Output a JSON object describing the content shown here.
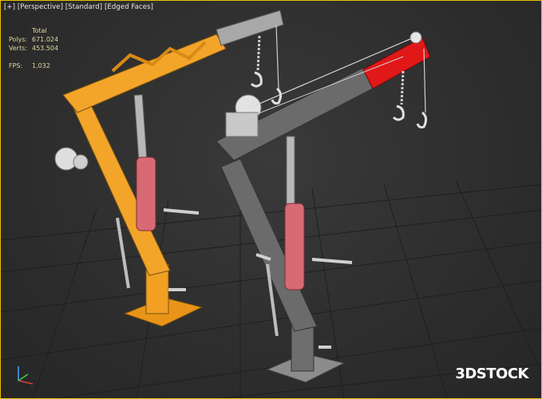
{
  "viewport": {
    "label_parts": [
      "[+]",
      "[Perspective]",
      "[Standard]",
      "[Edged Faces]"
    ],
    "stats": {
      "header": "Total",
      "polys_label": "Polys:",
      "polys_value": "671.024",
      "verts_label": "Verts:",
      "verts_value": "453.504",
      "fps_label": "FPS:",
      "fps_value": "1,032"
    },
    "watermark": {
      "part1": "3D",
      "part2": "STOCK"
    },
    "colors": {
      "border": "#e6c200",
      "crane_left": "#f2a023",
      "crane_right": "#6b6b6b",
      "boom_tip": "#e01818",
      "cylinder": "#d86a74"
    }
  }
}
